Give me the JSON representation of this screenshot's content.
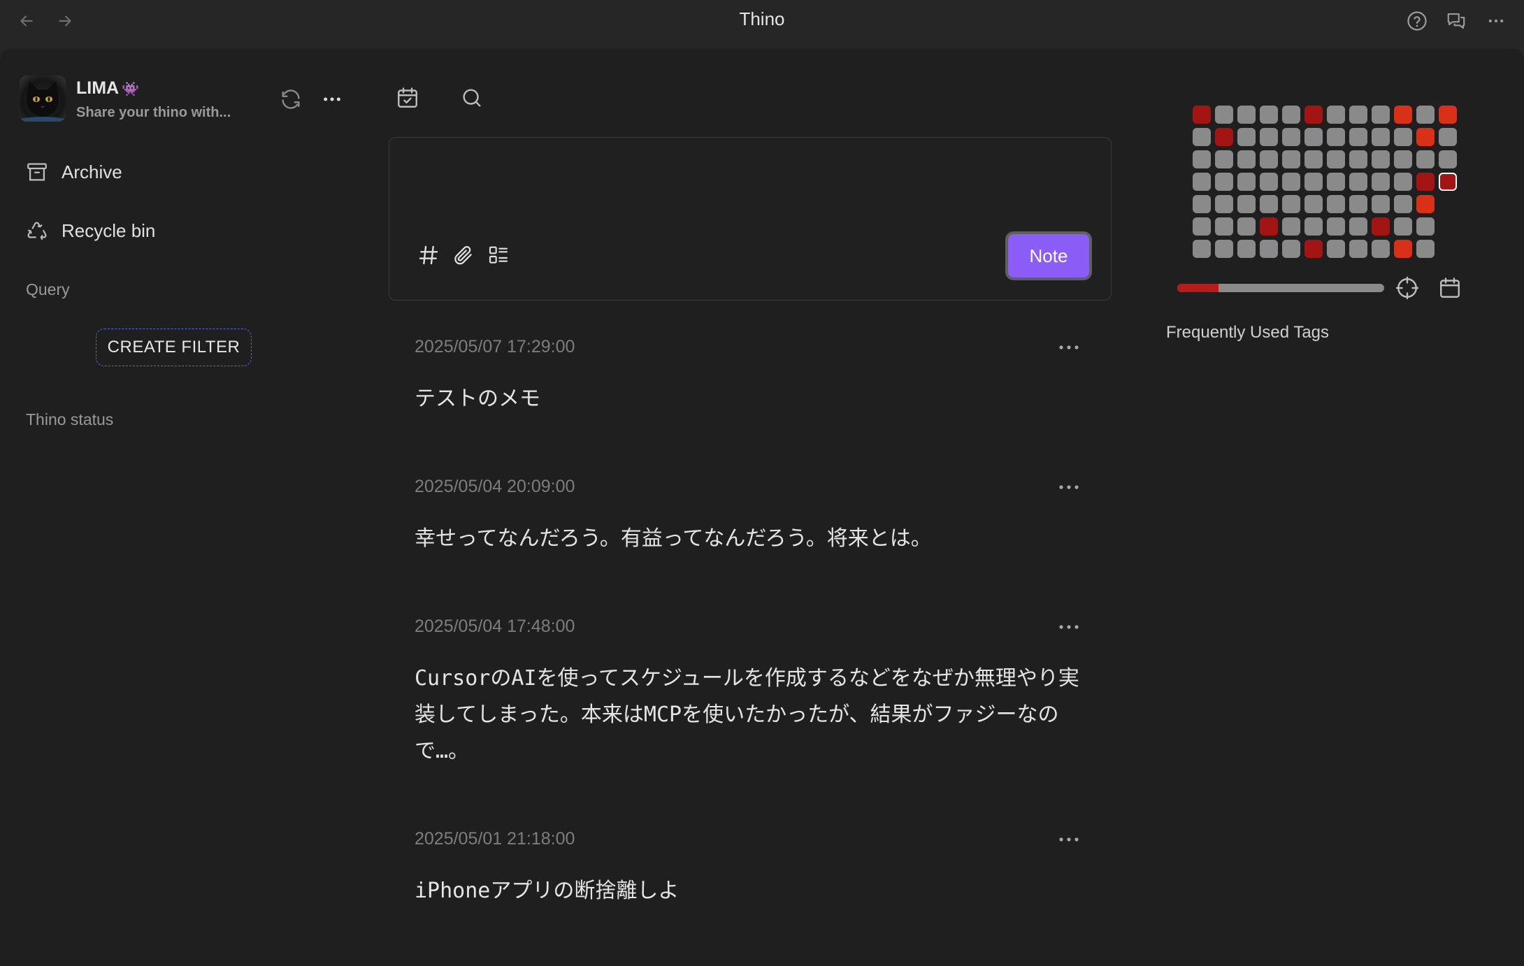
{
  "titlebar": {
    "title": "Thino"
  },
  "profile": {
    "name": "LIMA",
    "name_emoji": "👾",
    "subtitle": "Share your thino with..."
  },
  "sidebar": {
    "items": [
      {
        "label": "Archive",
        "icon": "archive-icon"
      },
      {
        "label": "Recycle bin",
        "icon": "recycle-icon"
      }
    ],
    "query_label": "Query",
    "create_filter_label": "CREATE FILTER",
    "status_label": "Thino status"
  },
  "editor": {
    "placeholder": "",
    "note_button_label": "Note",
    "accent_color": "#8b5cf6"
  },
  "memos": [
    {
      "time": "2025/05/07 17:29:00",
      "text": "テストのメモ"
    },
    {
      "time": "2025/05/04 20:09:00",
      "text": "幸せってなんだろう。有益ってなんだろう。将来とは。"
    },
    {
      "time": "2025/05/04 17:48:00",
      "text": "CursorのAIを使ってスケジュールを作成するなどをなぜか無理やり実装してしまった。本来はMCPを使いたかったが、結果がファジーなので…。"
    },
    {
      "time": "2025/05/01 21:18:00",
      "text": "iPhoneアプリの断捨離しよ"
    }
  ],
  "heatmap": {
    "colors": {
      "empty": "#8a8a8a",
      "dark": "#a31515",
      "bright": "#d93018"
    },
    "rows": [
      [
        "dark",
        "empty",
        "empty",
        "empty",
        "empty",
        "dark",
        "empty",
        "empty",
        "empty",
        "bright",
        "empty",
        "bright"
      ],
      [
        "empty",
        "dark",
        "empty",
        "empty",
        "empty",
        "empty",
        "empty",
        "empty",
        "empty",
        "empty",
        "bright",
        "empty"
      ],
      [
        "empty",
        "empty",
        "empty",
        "empty",
        "empty",
        "empty",
        "empty",
        "empty",
        "empty",
        "empty",
        "empty",
        "empty"
      ],
      [
        "empty",
        "empty",
        "empty",
        "empty",
        "empty",
        "empty",
        "empty",
        "empty",
        "empty",
        "empty",
        "dark",
        "today"
      ],
      [
        "empty",
        "empty",
        "empty",
        "empty",
        "empty",
        "empty",
        "empty",
        "empty",
        "empty",
        "empty",
        "bright",
        null
      ],
      [
        "empty",
        "empty",
        "empty",
        "dark",
        "empty",
        "empty",
        "empty",
        "empty",
        "dark",
        "empty",
        "empty",
        null
      ],
      [
        "empty",
        "empty",
        "empty",
        "empty",
        "empty",
        "dark",
        "empty",
        "empty",
        "empty",
        "bright",
        "empty",
        null
      ]
    ],
    "range_fraction": 0.2
  },
  "tags": {
    "title": "Frequently Used Tags"
  }
}
